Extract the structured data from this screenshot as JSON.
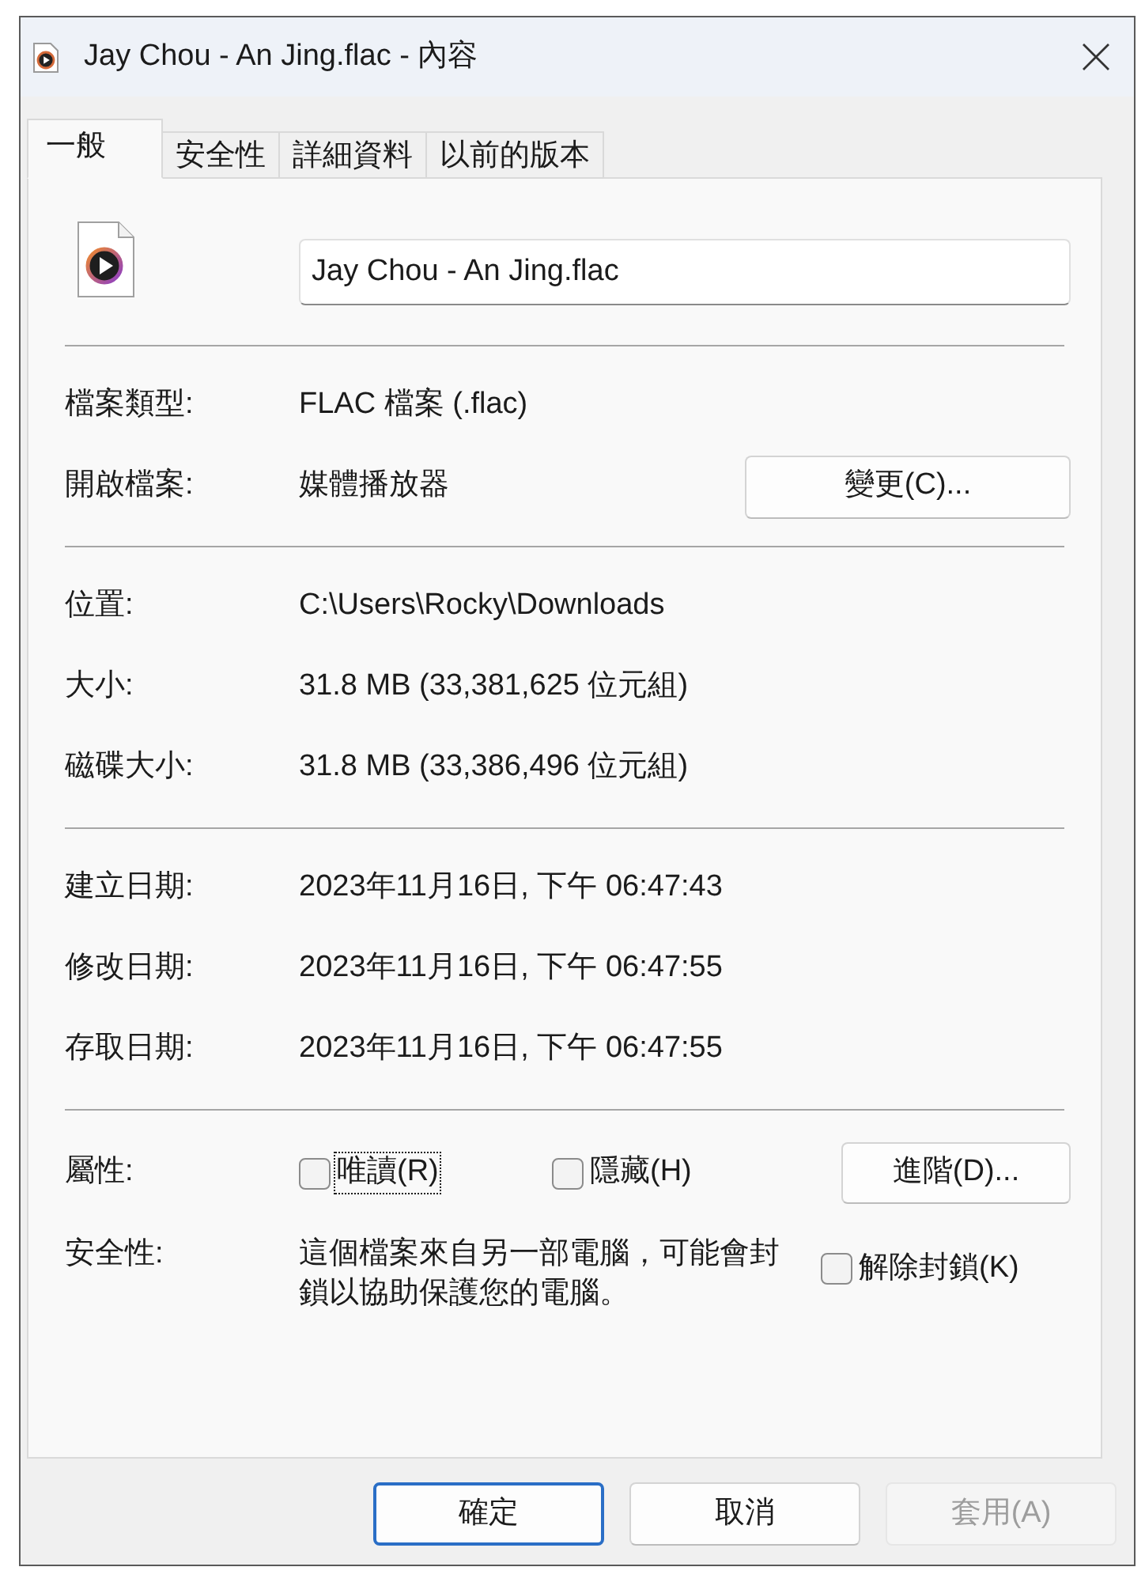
{
  "window": {
    "title": "Jay Chou - An Jing.flac - 內容"
  },
  "tabs": [
    {
      "label": "一般",
      "selected": true
    },
    {
      "label": "安全性",
      "selected": false
    },
    {
      "label": "詳細資料",
      "selected": false
    },
    {
      "label": "以前的版本",
      "selected": false
    }
  ],
  "general_tab": {
    "file_name": "Jay Chou - An Jing.flac",
    "sections": [
      {
        "rows": [
          {
            "label": "檔案類型:",
            "value": "FLAC 檔案 (.flac)"
          },
          {
            "label": "開啟檔案:",
            "value": "媒體播放器",
            "button": "變更(C)..."
          }
        ]
      },
      {
        "rows": [
          {
            "label": "位置:",
            "value": "C:\\Users\\Rocky\\Downloads"
          },
          {
            "label": "大小:",
            "value": "31.8 MB (33,381,625 位元組)"
          },
          {
            "label": "磁碟大小:",
            "value": "31.8 MB (33,386,496 位元組)"
          }
        ]
      },
      {
        "rows": [
          {
            "label": "建立日期:",
            "value": "2023年11月16日, 下午 06:47:43"
          },
          {
            "label": "修改日期:",
            "value": "2023年11月16日, 下午 06:47:55"
          },
          {
            "label": "存取日期:",
            "value": "2023年11月16日, 下午 06:47:55"
          }
        ]
      }
    ],
    "attributes": {
      "label": "屬性:",
      "options": [
        {
          "label": "唯讀(R)",
          "checked": false,
          "focused": true
        },
        {
          "label": "隱藏(H)",
          "checked": false,
          "focused": false
        }
      ],
      "button": "進階(D)..."
    },
    "security": {
      "label": "安全性:",
      "text": "這個檔案來自另一部電腦，可能會封鎖以協助保護您的電腦。",
      "unblock": {
        "label": "解除封鎖(K)",
        "checked": false,
        "focused": false
      }
    }
  },
  "buttons": [
    {
      "label": "確定",
      "default": true,
      "disabled": false
    },
    {
      "label": "取消",
      "default": false,
      "disabled": false
    },
    {
      "label": "套用(A)",
      "default": false,
      "disabled": true
    }
  ]
}
